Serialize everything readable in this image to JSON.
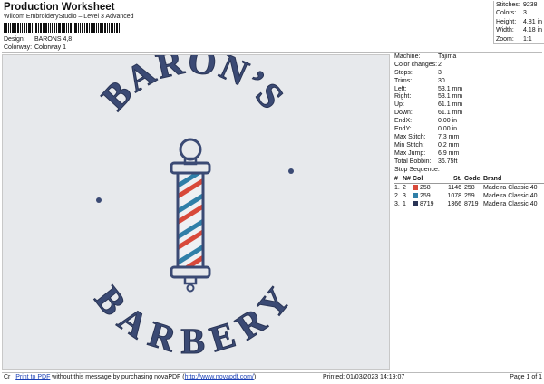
{
  "header": {
    "title": "Production Worksheet",
    "subtitle": "Wilcom EmbroideryStudio – Level 3 Advanced",
    "design_label": "Design:",
    "design_value": "BARONS 4,8",
    "colorway_label": "Colorway:",
    "colorway_value": "Colorway 1"
  },
  "stats": [
    {
      "label": "Stitches:",
      "value": "9238"
    },
    {
      "label": "Colors:",
      "value": "3"
    },
    {
      "label": "Height:",
      "value": "4.81 in"
    },
    {
      "label": "Width:",
      "value": "4.18 in"
    },
    {
      "label": "Zoom:",
      "value": "1:1"
    }
  ],
  "design": {
    "top_text": "BARON’S",
    "bottom_text": "BARBERY",
    "colors": {
      "navy": "#3b4a74",
      "navy_dark": "#2a3556",
      "red": "#d8493a",
      "blue": "#2f7fa8",
      "background": "#e7e9ec"
    }
  },
  "params": [
    {
      "label": "Machine:",
      "value": "Tajima"
    },
    {
      "label": "Color changes:",
      "value": "2"
    },
    {
      "label": "Stops:",
      "value": "3"
    },
    {
      "label": "Trims:",
      "value": "30"
    },
    {
      "label": "Left:",
      "value": "53.1 mm"
    },
    {
      "label": "Right:",
      "value": "53.1 mm"
    },
    {
      "label": "Up:",
      "value": "61.1 mm"
    },
    {
      "label": "Down:",
      "value": "61.1 mm"
    },
    {
      "label": "EndX:",
      "value": "0.00 in"
    },
    {
      "label": "EndY:",
      "value": "0.00 in"
    },
    {
      "label": "Max Stitch:",
      "value": "7.3 mm"
    },
    {
      "label": "Min Stitch:",
      "value": "0.2 mm"
    },
    {
      "label": "Max Jump:",
      "value": "6.9 mm"
    },
    {
      "label": "Total Bobbin:",
      "value": "36.75ft"
    }
  ],
  "stop_sequence": {
    "title": "Stop Sequence:",
    "headers": [
      "#",
      "N#",
      "Col",
      "St.",
      "Code",
      "Brand"
    ],
    "rows": [
      {
        "num": "1.",
        "n": "2",
        "color": "#d8493a",
        "code_label": "258",
        "st": "1146",
        "code": "258",
        "brand": "Madeira Classic 40"
      },
      {
        "num": "2.",
        "n": "3",
        "color": "#2f7fa8",
        "code_label": "259",
        "st": "1078",
        "code": "259",
        "brand": "Madeira Classic 40"
      },
      {
        "num": "3.",
        "n": "1",
        "color": "#2a3556",
        "code_label": "8719",
        "st": "1366",
        "code": "8719",
        "brand": "Madeira Classic 40"
      }
    ]
  },
  "footer": {
    "prefix": "Cr",
    "link_text": "Print to PDF",
    "middle_text": " without this message by purchasing novaPDF (",
    "url_text": "http://www.novapdf.com/",
    "suffix": ")",
    "printed": "Printed: 01/03/2023 14:19:07",
    "page": "Page 1 of 1"
  }
}
